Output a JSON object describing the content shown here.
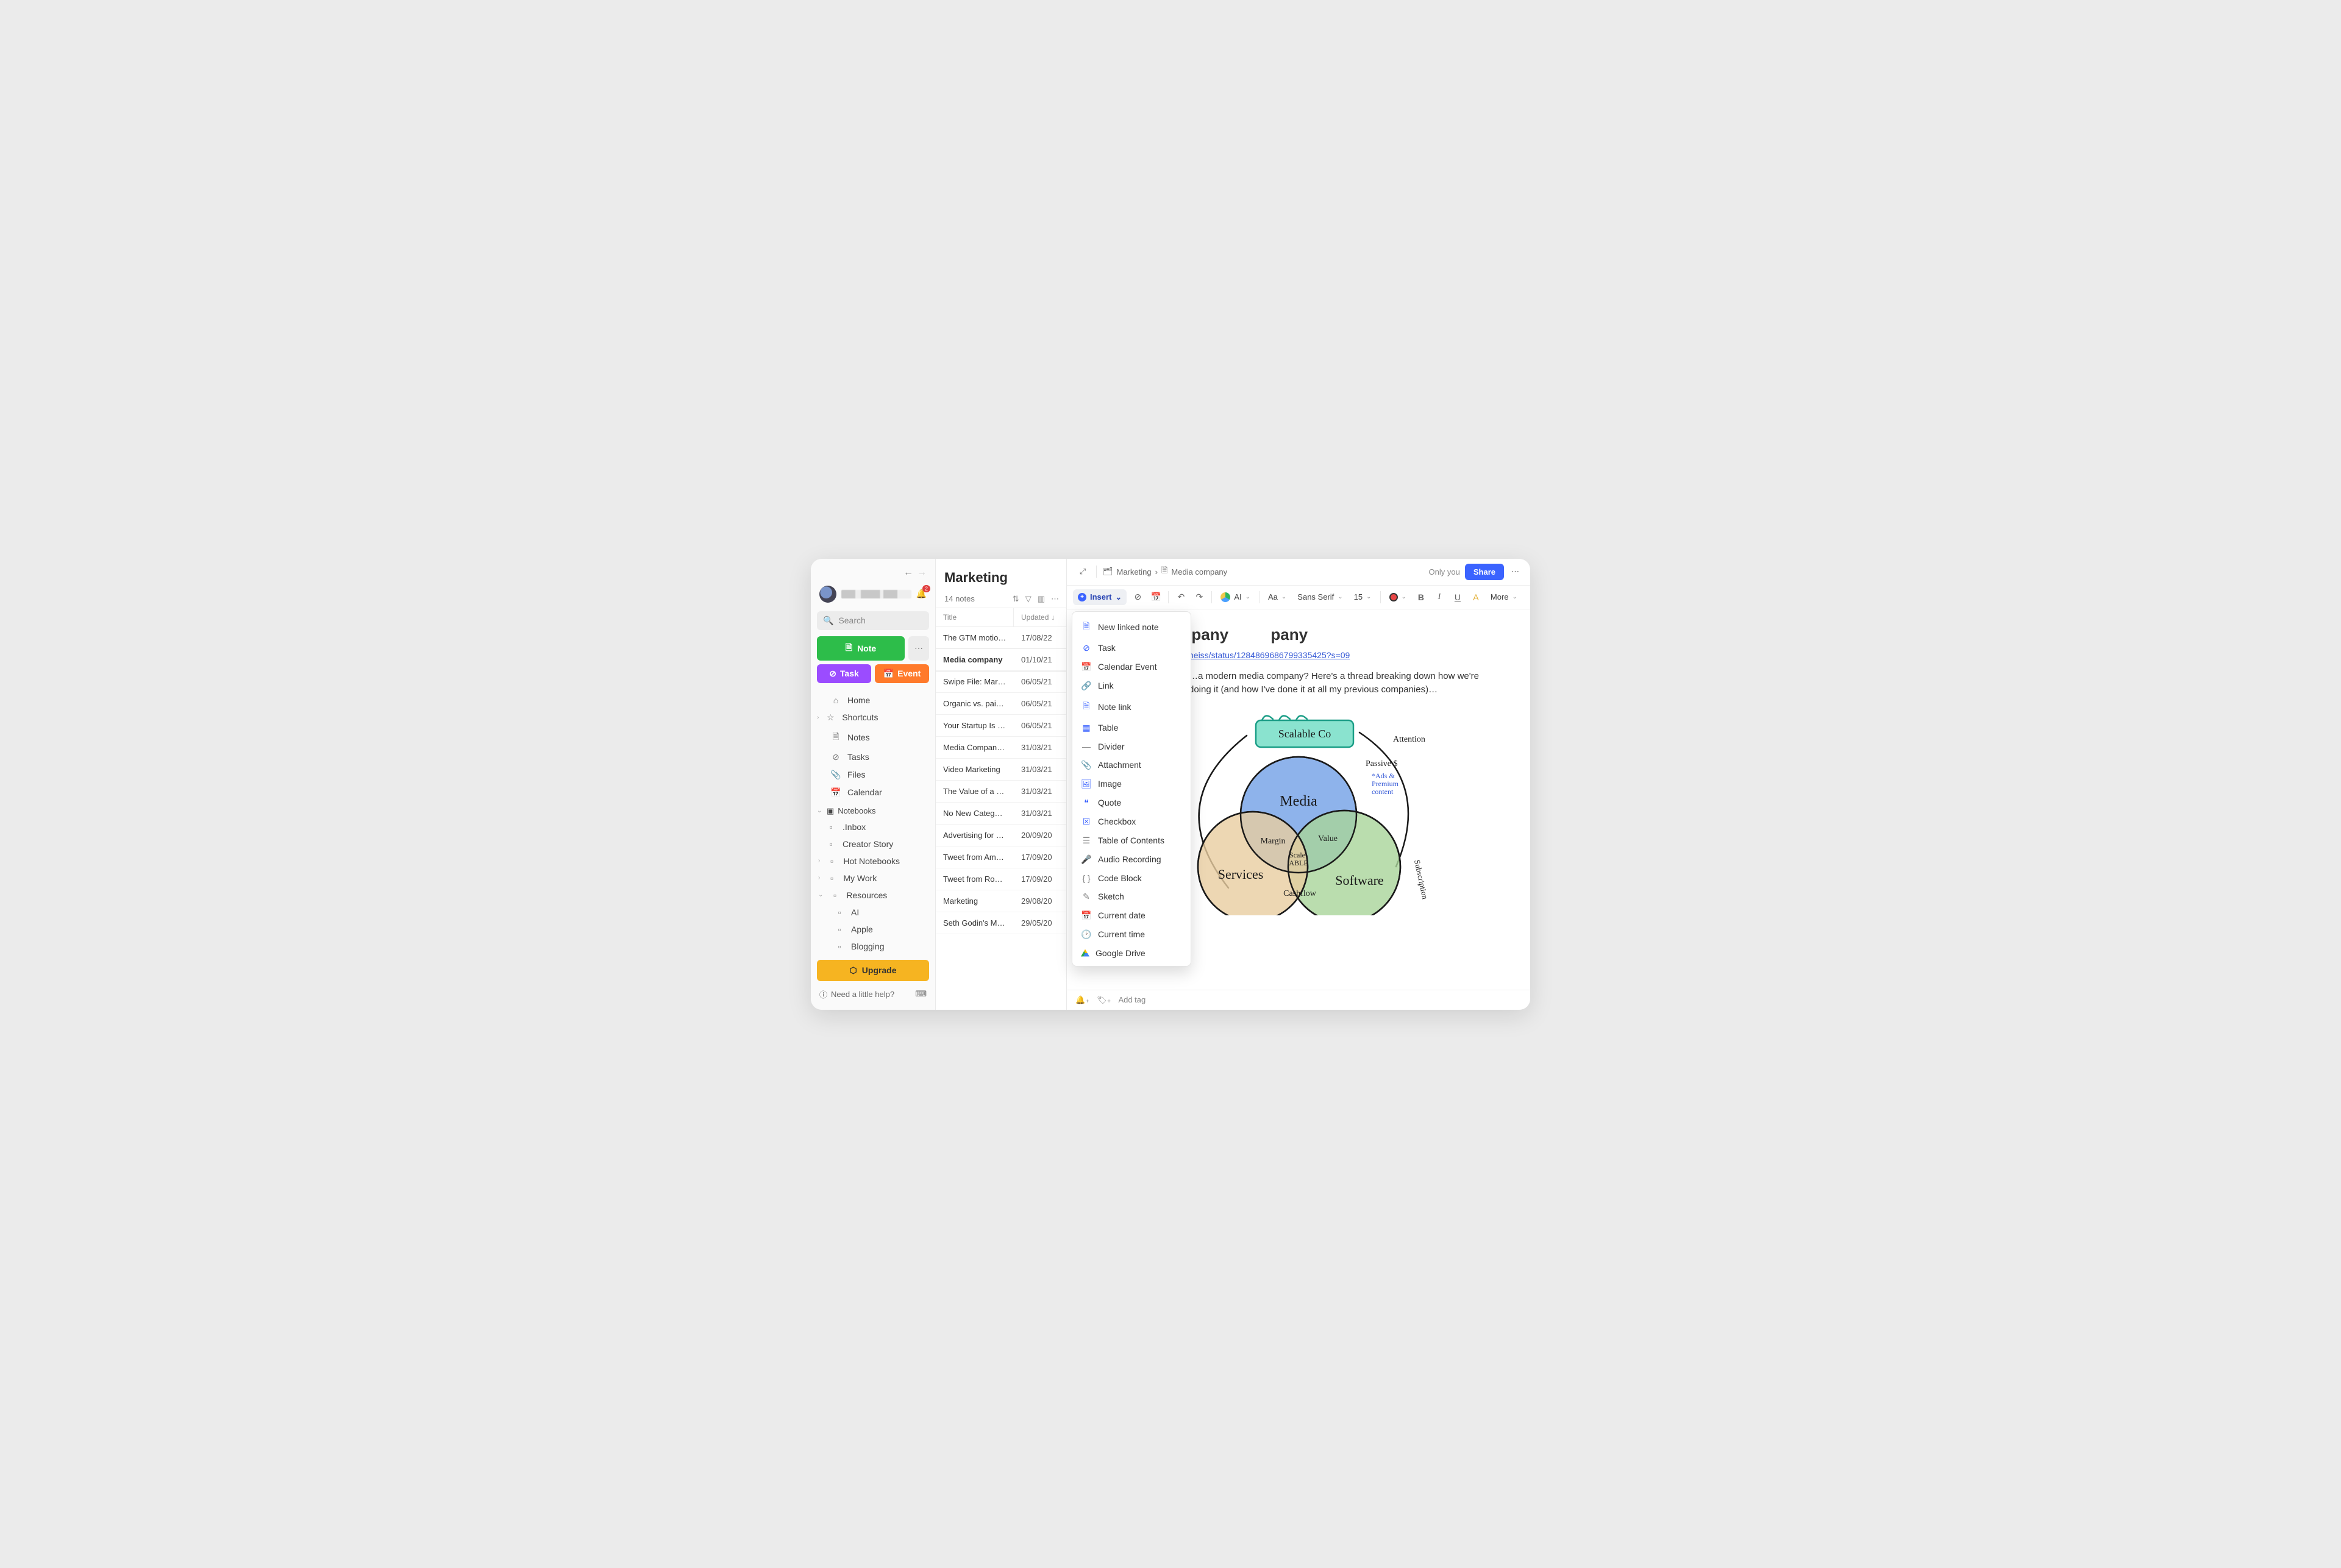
{
  "sidebar": {
    "search_placeholder": "Search",
    "note_btn": "Note",
    "task_btn": "Task",
    "event_btn": "Event",
    "bell_badge": "2",
    "nav": [
      {
        "icon": "⌂",
        "label": "Home"
      },
      {
        "icon": "☆",
        "label": "Shortcuts",
        "caret": true
      },
      {
        "icon": "🗎",
        "label": "Notes"
      },
      {
        "icon": "⊘",
        "label": "Tasks"
      },
      {
        "icon": "📎",
        "label": "Files"
      },
      {
        "icon": "📅",
        "label": "Calendar"
      }
    ],
    "notebooks_label": "Notebooks",
    "notebooks": [
      {
        "label": ".Inbox",
        "depth": 1
      },
      {
        "label": "Creator Story",
        "depth": 1
      },
      {
        "label": "Hot Notebooks",
        "depth": 1,
        "caret": true
      },
      {
        "label": "My Work",
        "depth": 1,
        "caret": true
      },
      {
        "label": "Resources",
        "depth": 1,
        "caret": true,
        "open": true
      },
      {
        "label": "AI",
        "depth": 2
      },
      {
        "label": "Apple",
        "depth": 2
      },
      {
        "label": "Blogging",
        "depth": 2
      }
    ],
    "upgrade": "Upgrade",
    "help": "Need a little help?"
  },
  "notelist": {
    "title": "Marketing",
    "count": "14 notes",
    "col_title": "Title",
    "col_updated": "Updated",
    "rows": [
      {
        "t": "The GTM motions o…",
        "d": "17/08/22"
      },
      {
        "t": "Media company",
        "d": "01/10/21",
        "sel": true
      },
      {
        "t": "Swipe File: Marketin…",
        "d": "06/05/21"
      },
      {
        "t": "Organic vs. paid ma…",
        "d": "06/05/21"
      },
      {
        "t": "Your Startup Is a M…",
        "d": "06/05/21"
      },
      {
        "t": "Media Company Ma…",
        "d": "31/03/21"
      },
      {
        "t": "Video Marketing",
        "d": "31/03/21"
      },
      {
        "t": "The Value of a Velv…",
        "d": "31/03/21"
      },
      {
        "t": "No New Categories",
        "d": "31/03/21"
      },
      {
        "t": "Advertising for new …",
        "d": "20/09/20"
      },
      {
        "t": "Tweet from Amanda…",
        "d": "17/09/20"
      },
      {
        "t": "Tweet from Rob Wal…",
        "d": "17/09/20"
      },
      {
        "t": "Marketing",
        "d": "29/08/20"
      },
      {
        "t": "Seth Godin's Market…",
        "d": "29/05/20"
      }
    ]
  },
  "editor": {
    "breadcrumb_parent": "Marketing",
    "breadcrumb_note": "Media company",
    "only_you": "Only you",
    "share": "Share",
    "insert_label": "Insert",
    "ai_label": "AI",
    "font_family": "Sans Serif",
    "font_size": "15",
    "more": "More",
    "note_title": "Media company",
    "note_link": "heiss/status/1284869686799335425?s=09",
    "note_para": "…a modern media company? Here's a thread breaking down how we're doing it (and how I've done it at all my previous companies)…",
    "add_tag": "Add tag",
    "font_label": "Aa"
  },
  "insert_menu": [
    {
      "icon": "🗎",
      "cls": "blue",
      "label": "New linked note"
    },
    {
      "icon": "⊘",
      "cls": "blue",
      "label": "Task"
    },
    {
      "icon": "📅",
      "cls": "orange",
      "label": "Calendar Event"
    },
    {
      "icon": "🔗",
      "cls": "blue",
      "label": "Link"
    },
    {
      "icon": "🗎",
      "cls": "blue",
      "label": "Note link"
    },
    {
      "icon": "▦",
      "cls": "blue",
      "label": "Table"
    },
    {
      "icon": "—",
      "cls": "pl",
      "label": "Divider"
    },
    {
      "icon": "📎",
      "cls": "pl",
      "label": "Attachment"
    },
    {
      "icon": "🖼",
      "cls": "blue",
      "label": "Image"
    },
    {
      "icon": "❝",
      "cls": "blue",
      "label": "Quote"
    },
    {
      "icon": "☒",
      "cls": "blue",
      "label": "Checkbox"
    },
    {
      "icon": "☰",
      "cls": "pl",
      "label": "Table of Contents"
    },
    {
      "icon": "🎤",
      "cls": "blue",
      "label": "Audio Recording"
    },
    {
      "icon": "{ }",
      "cls": "pl",
      "label": "Code Block"
    },
    {
      "icon": "✎",
      "cls": "pl",
      "label": "Sketch"
    },
    {
      "icon": "📅",
      "cls": "blue",
      "label": "Current date"
    },
    {
      "icon": "🕑",
      "cls": "blue",
      "label": "Current time"
    },
    {
      "icon": "gdrive",
      "cls": "",
      "label": "Google Drive"
    }
  ],
  "sketch": {
    "top_label": "Scalable Co",
    "c1": "Media",
    "c2": "Software",
    "c3": "Services",
    "center": "Scale-\nABLE",
    "o12": "Value",
    "o13": "Margin",
    "o23": "Cashflow",
    "right_top": "Passive $",
    "right_ads": "*Ads &\nPremium\ncontent",
    "arc_top": "Attention",
    "arc_right": "Subscription"
  }
}
